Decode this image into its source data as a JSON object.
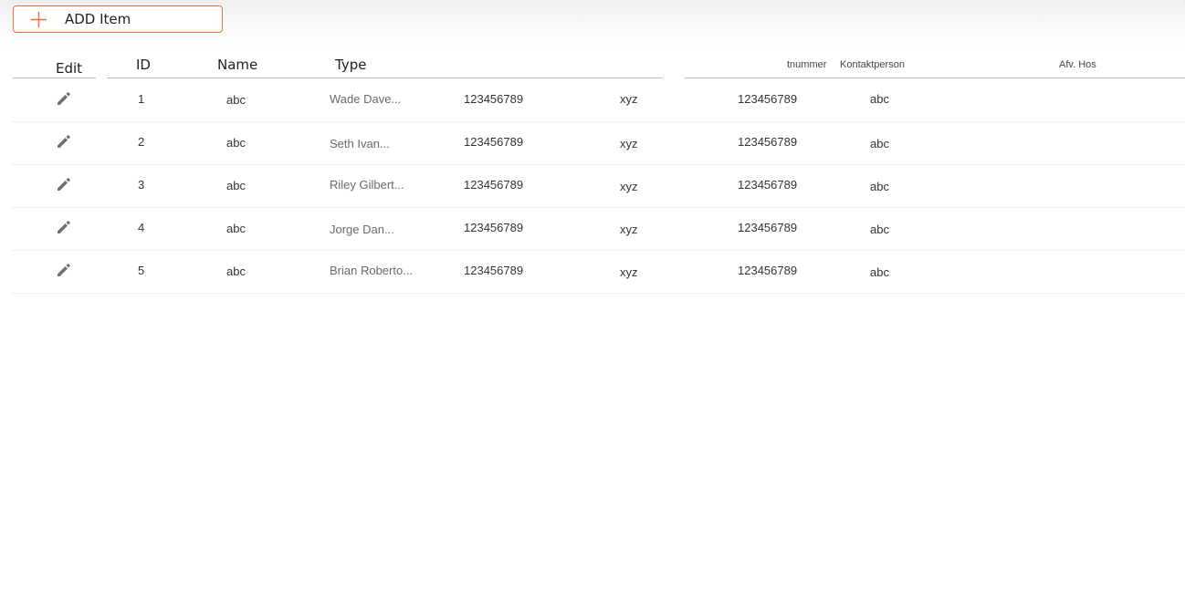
{
  "toolbar": {
    "add_label": "ADD Item",
    "accent_color": "#e8703f"
  },
  "headers": {
    "edit": "Edit",
    "id": "ID",
    "name": "Name",
    "type": "Type",
    "col_nummer": "tnummer",
    "col_kontakt": "Kontaktperson",
    "col_afv": "Afv. Hos"
  },
  "rows": [
    {
      "id": "1",
      "name": "abc",
      "type": "Wade Dave...",
      "num": "123456789",
      "code": "xyz",
      "num2": "123456789",
      "contact": "abc"
    },
    {
      "id": "2",
      "name": "abc",
      "type": "Seth Ivan...",
      "num": "123456789",
      "code": "xyz",
      "num2": "123456789",
      "contact": "abc"
    },
    {
      "id": "3",
      "name": "abc",
      "type": "Riley Gilbert...",
      "num": "123456789",
      "code": "xyz",
      "num2": "123456789",
      "contact": "abc"
    },
    {
      "id": "4",
      "name": "abc",
      "type": "Jorge Dan...",
      "num": "123456789",
      "code": "xyz",
      "num2": "123456789",
      "contact": "abc"
    },
    {
      "id": "5",
      "name": "abc",
      "type": "Brian Roberto...",
      "num": "123456789",
      "code": "xyz",
      "num2": "123456789",
      "contact": "abc"
    }
  ]
}
